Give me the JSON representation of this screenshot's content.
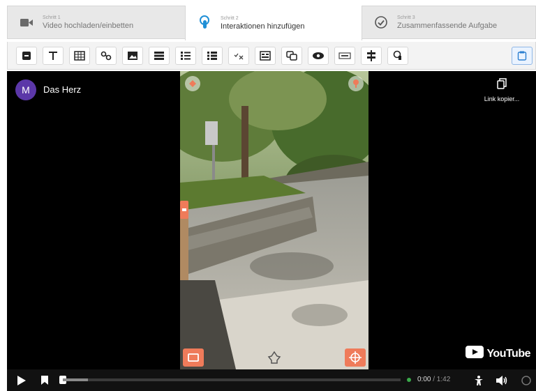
{
  "steps": [
    {
      "number": "Schritt 1",
      "label": "Video hochladen/einbetten",
      "icon": "video-camera-icon"
    },
    {
      "number": "Schritt 2",
      "label": "Interaktionen hinzufügen",
      "icon": "touch-icon"
    },
    {
      "number": "Schritt 3",
      "label": "Zusammenfassende Aufgabe",
      "icon": "check-circle-icon"
    }
  ],
  "toolbar": {
    "tools": [
      "label-icon",
      "text-icon",
      "table-icon",
      "link-icon",
      "image-icon",
      "statements-icon",
      "single-choice-icon",
      "multiple-choice-icon",
      "true-false-icon",
      "fill-blanks-icon",
      "drag-drop-icon",
      "mark-words-icon",
      "drag-text-icon",
      "crossroads-icon",
      "navigation-hotspot-icon"
    ],
    "right": "bookmark-panel-icon"
  },
  "video": {
    "channel_initial": "M",
    "title": "Das Herz",
    "copy_link_label": "Link kopier...",
    "youtube_label": "YouTube"
  },
  "player": {
    "current_time": "0:00",
    "duration": "/ 1:42",
    "accent_color": "#ef7b5a"
  }
}
